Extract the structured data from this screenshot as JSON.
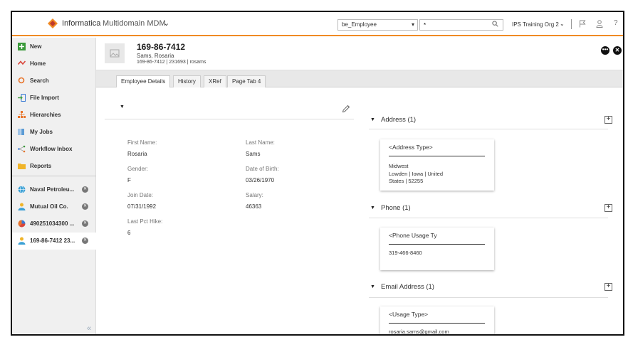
{
  "topbar": {
    "brand": "Informatica",
    "product": "Multidomain MDM",
    "entity_select": "be_Employee",
    "search_value": "*",
    "org": "IPS Training Org 2",
    "help": "?"
  },
  "sidebar": {
    "nav": [
      {
        "label": "New"
      },
      {
        "label": "Home"
      },
      {
        "label": "Search"
      },
      {
        "label": "File Import"
      },
      {
        "label": "Hierarchies"
      },
      {
        "label": "My Jobs"
      },
      {
        "label": "Workflow Inbox"
      },
      {
        "label": "Reports"
      }
    ],
    "records": [
      {
        "label": "Naval Petroleu..."
      },
      {
        "label": "Mutual Oil Co."
      },
      {
        "label": "490251034300 ..."
      },
      {
        "label": "169-86-7412 23..."
      }
    ],
    "collapse": "«"
  },
  "header": {
    "title": "169-86-7412",
    "name": "Sams, Rosaria",
    "sub": "169-86-7412 | 231693 | rosams"
  },
  "tabs": [
    {
      "label": "Employee Details"
    },
    {
      "label": "History"
    },
    {
      "label": "XRef"
    },
    {
      "label": "Page Tab 4"
    }
  ],
  "details": {
    "first_name_label": "First Name:",
    "first_name": "Rosaria",
    "last_name_label": "Last Name:",
    "last_name": "Sams",
    "gender_label": "Gender:",
    "gender": "F",
    "dob_label": "Date of Birth:",
    "dob": "03/26/1970",
    "join_label": "Join Date:",
    "join": "07/31/1992",
    "salary_label": "Salary:",
    "salary": "46363",
    "hike_label": "Last Pct Hike:",
    "hike": "6"
  },
  "address": {
    "title": "Address (1)",
    "card_title": "<Address Type>",
    "line1": "Midwest",
    "line2": "Lowden | Iowa | United",
    "line3": "States | 52255"
  },
  "phone": {
    "title": "Phone (1)",
    "card_title": "<Phone Usage Ty",
    "value": "319-466-8460"
  },
  "email": {
    "title": "Email Address (1)",
    "card_title": "<Usage Type>",
    "value": "rosaria.sams@gmail.com"
  },
  "colors": {
    "accent": "#f08a24",
    "sidebar_bg": "#f0f0f0",
    "tabbar_bg": "#e8e8e8"
  },
  "icons": [
    "informatica-logo-icon",
    "chevron-down-icon",
    "search-icon",
    "flag-icon",
    "user-icon",
    "help-icon",
    "plus-icon",
    "home-icon",
    "search-nav-icon",
    "file-import-icon",
    "hierarchies-icon",
    "my-jobs-icon",
    "workflow-icon",
    "reports-icon",
    "globe-icon",
    "person-icon",
    "pie-icon",
    "pencil-icon",
    "more-icon",
    "close-icon"
  ]
}
